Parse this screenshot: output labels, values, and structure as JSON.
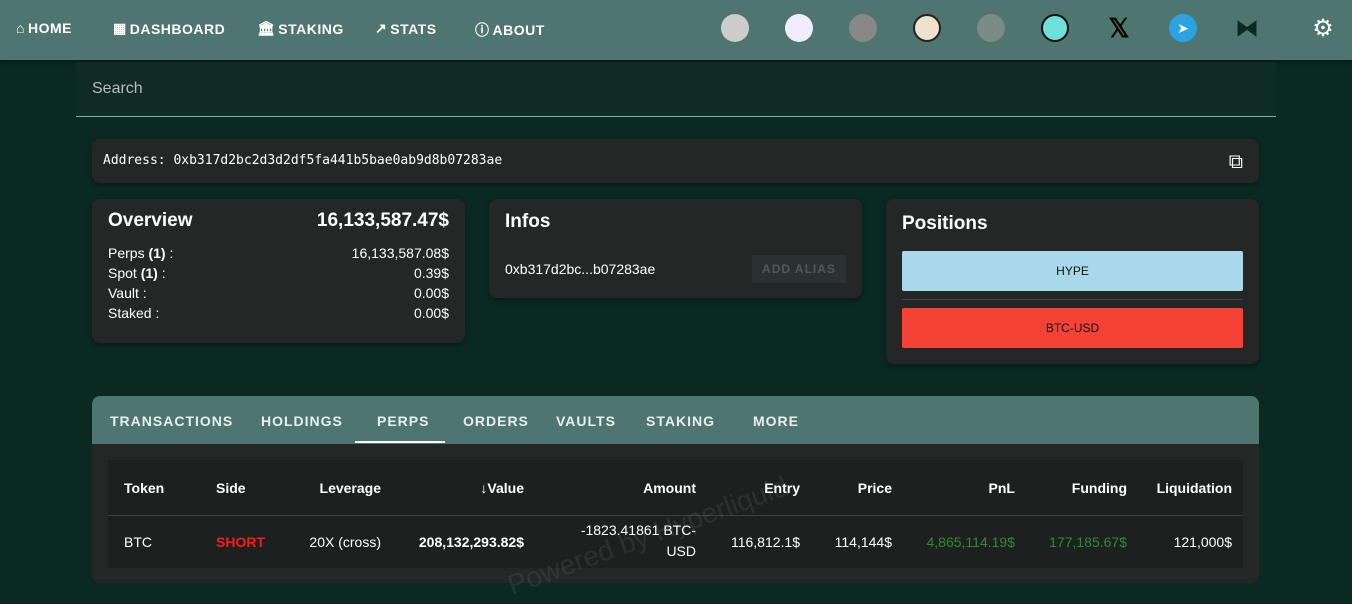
{
  "nav": {
    "items": [
      {
        "label": "HOME",
        "icon": "home-icon"
      },
      {
        "label": "DASHBOARD",
        "icon": "grid-icon"
      },
      {
        "label": "STAKING",
        "icon": "bank-icon"
      },
      {
        "label": "STATS",
        "icon": "trend-icon"
      },
      {
        "label": "ABOUT",
        "icon": "info-icon"
      }
    ],
    "icons": [
      "cat-icon",
      "white-cat-icon",
      "skull-icon",
      "lion-icon",
      "monkey-icon",
      "bridge-icon",
      "x-icon",
      "telegram-icon",
      "hyperliquid-icon",
      "gear-icon"
    ]
  },
  "search": {
    "placeholder": "Search"
  },
  "address": {
    "label": "Address: 0xb317d2bc2d3d2df5fa441b5bae0ab9d8b07283ae"
  },
  "overview": {
    "title": "Overview",
    "total": "16,133,587.47$",
    "rows": [
      {
        "label": "Perps",
        "count": "(1)",
        "value": "16,133,587.08$"
      },
      {
        "label": "Spot",
        "count": "(1)",
        "value": "0.39$"
      },
      {
        "label": "Vault",
        "count": "",
        "value": "0.00$"
      },
      {
        "label": "Staked",
        "count": "",
        "value": "0.00$"
      }
    ]
  },
  "infos": {
    "title": "Infos",
    "short_address": "0xb317d2bc...b07283ae",
    "add_alias": "ADD ALIAS"
  },
  "positions": {
    "title": "Positions",
    "items": [
      "HYPE",
      "BTC-USD"
    ]
  },
  "tabs": [
    "TRANSACTIONS",
    "HOLDINGS",
    "PERPS",
    "ORDERS",
    "VAULTS",
    "STAKING",
    "MORE"
  ],
  "active_tab": "PERPS",
  "table": {
    "headers": [
      "Token",
      "Side",
      "Leverage",
      "Value",
      "Amount",
      "Entry",
      "Price",
      "PnL",
      "Funding",
      "Liquidation"
    ],
    "rows": [
      [
        "BTC",
        "SHORT",
        "20X (cross)",
        "208,132,293.82$",
        "-1823.41861 BTC-USD",
        "116,812.1$",
        "114,144$",
        "4,865,114.19$",
        "177,185.67$",
        "121,000$"
      ]
    ]
  },
  "watermark": "Powered by Hyperliquid",
  "colors": {
    "nav": "#4e756f",
    "short": "#ff1a1a",
    "pnl": "#2e8b2e",
    "hype": "#a8d8ea",
    "btc": "#f44336"
  }
}
